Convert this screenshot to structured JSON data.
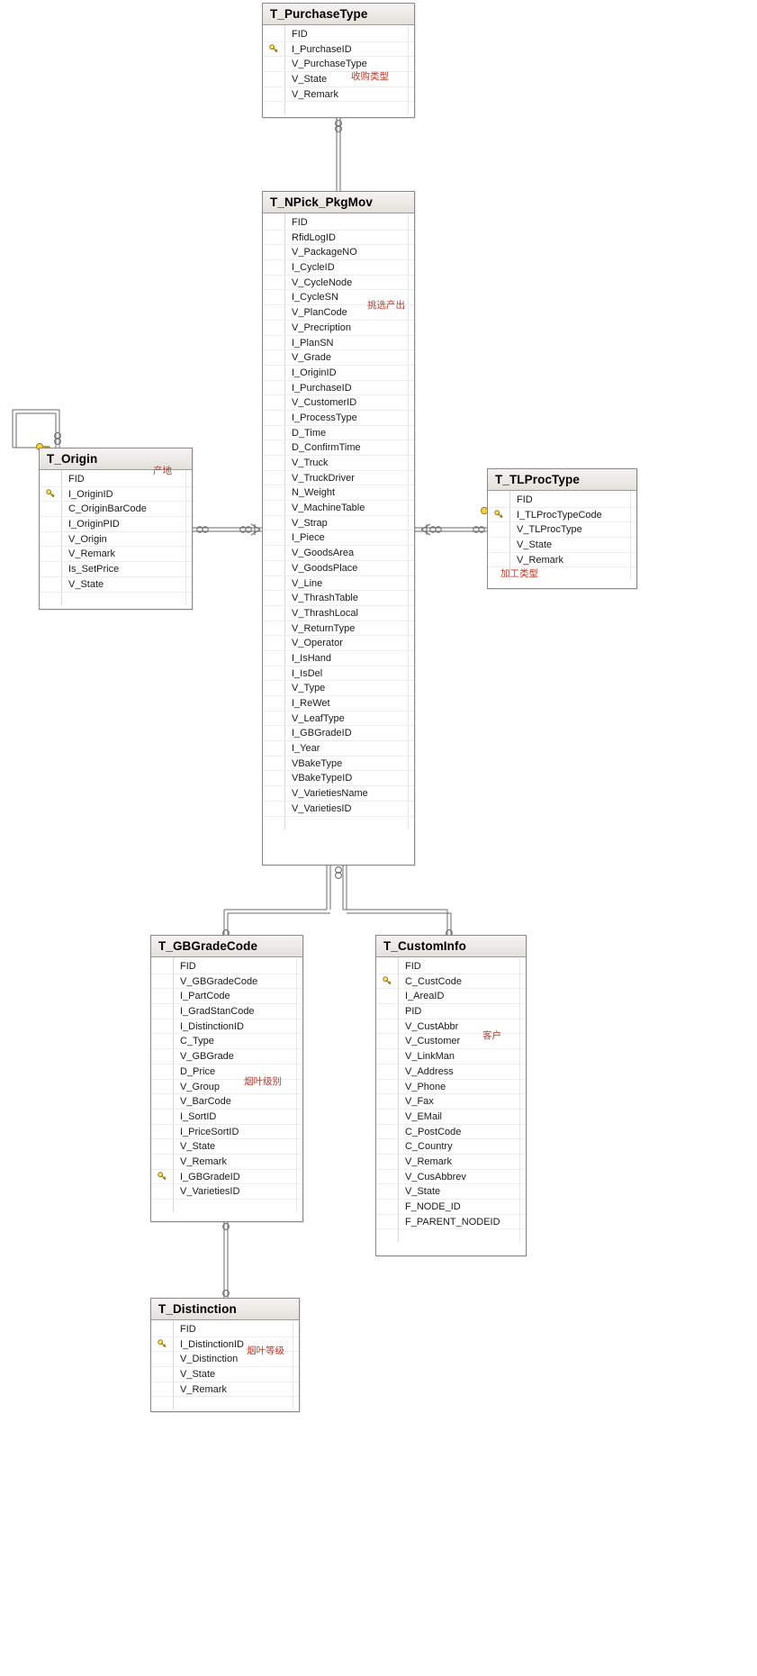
{
  "diagram": {
    "title": "Database ER Diagram",
    "accent_note_color": "#c0392b",
    "border_color": "#8a8a8a"
  },
  "entities": [
    {
      "id": "t-purchasetype",
      "name": "T_PurchaseType",
      "note": "收购类型",
      "fields": [
        {
          "name": "FID",
          "pk": false
        },
        {
          "name": "I_PurchaseID",
          "pk": true
        },
        {
          "name": "V_PurchaseType",
          "pk": false
        },
        {
          "name": "V_State",
          "pk": false
        },
        {
          "name": "V_Remark",
          "pk": false
        }
      ]
    },
    {
      "id": "t-npick-pkgmov",
      "name": "T_NPick_PkgMov",
      "note": "挑选产出",
      "fields": [
        {
          "name": "FID",
          "pk": false
        },
        {
          "name": "RfidLogID",
          "pk": false
        },
        {
          "name": "V_PackageNO",
          "pk": false
        },
        {
          "name": "I_CycleID",
          "pk": false
        },
        {
          "name": "V_CycleNode",
          "pk": false
        },
        {
          "name": "I_CycleSN",
          "pk": false
        },
        {
          "name": "V_PlanCode",
          "pk": false
        },
        {
          "name": "V_Precription",
          "pk": false
        },
        {
          "name": "I_PlanSN",
          "pk": false
        },
        {
          "name": "V_Grade",
          "pk": false
        },
        {
          "name": "I_OriginID",
          "pk": false
        },
        {
          "name": "I_PurchaseID",
          "pk": false
        },
        {
          "name": "V_CustomerID",
          "pk": false
        },
        {
          "name": "I_ProcessType",
          "pk": false
        },
        {
          "name": "D_Time",
          "pk": false
        },
        {
          "name": "D_ConfirmTime",
          "pk": false
        },
        {
          "name": "V_Truck",
          "pk": false
        },
        {
          "name": "V_TruckDriver",
          "pk": false
        },
        {
          "name": "N_Weight",
          "pk": false
        },
        {
          "name": "V_MachineTable",
          "pk": false
        },
        {
          "name": "V_Strap",
          "pk": false
        },
        {
          "name": "I_Piece",
          "pk": false
        },
        {
          "name": "V_GoodsArea",
          "pk": false
        },
        {
          "name": "V_GoodsPlace",
          "pk": false
        },
        {
          "name": "V_Line",
          "pk": false
        },
        {
          "name": "V_ThrashTable",
          "pk": false
        },
        {
          "name": "V_ThrashLocal",
          "pk": false
        },
        {
          "name": "V_ReturnType",
          "pk": false
        },
        {
          "name": "V_Operator",
          "pk": false
        },
        {
          "name": "I_IsHand",
          "pk": false
        },
        {
          "name": "I_IsDel",
          "pk": false
        },
        {
          "name": "V_Type",
          "pk": false
        },
        {
          "name": "I_ReWet",
          "pk": false
        },
        {
          "name": "V_LeafType",
          "pk": false
        },
        {
          "name": "I_GBGradeID",
          "pk": false
        },
        {
          "name": "I_Year",
          "pk": false
        },
        {
          "name": "VBakeType",
          "pk": false
        },
        {
          "name": "VBakeTypeID",
          "pk": false
        },
        {
          "name": "V_VarietiesName",
          "pk": false
        },
        {
          "name": "V_VarietiesID",
          "pk": false
        }
      ]
    },
    {
      "id": "t-origin",
      "name": "T_Origin",
      "note": "产地",
      "fields": [
        {
          "name": "FID",
          "pk": false
        },
        {
          "name": "I_OriginID",
          "pk": true
        },
        {
          "name": "C_OriginBarCode",
          "pk": false
        },
        {
          "name": "I_OriginPID",
          "pk": false
        },
        {
          "name": "V_Origin",
          "pk": false
        },
        {
          "name": "V_Remark",
          "pk": false
        },
        {
          "name": "Is_SetPrice",
          "pk": false
        },
        {
          "name": "V_State",
          "pk": false
        }
      ]
    },
    {
      "id": "t-tlproctype",
      "name": "T_TLProcType",
      "note": "加工类型",
      "fields": [
        {
          "name": "FID",
          "pk": false
        },
        {
          "name": "I_TLProcTypeCode",
          "pk": true
        },
        {
          "name": "V_TLProcType",
          "pk": false
        },
        {
          "name": "V_State",
          "pk": false
        },
        {
          "name": "V_Remark",
          "pk": false
        }
      ]
    },
    {
      "id": "t-gbgradecode",
      "name": "T_GBGradeCode",
      "note": "烟叶级别",
      "fields": [
        {
          "name": "FID",
          "pk": false
        },
        {
          "name": "V_GBGradeCode",
          "pk": false
        },
        {
          "name": "I_PartCode",
          "pk": false
        },
        {
          "name": "I_GradStanCode",
          "pk": false
        },
        {
          "name": "I_DistinctionID",
          "pk": false
        },
        {
          "name": "C_Type",
          "pk": false
        },
        {
          "name": "V_GBGrade",
          "pk": false
        },
        {
          "name": "D_Price",
          "pk": false
        },
        {
          "name": "V_Group",
          "pk": false
        },
        {
          "name": "V_BarCode",
          "pk": false
        },
        {
          "name": "I_SortID",
          "pk": false
        },
        {
          "name": "I_PriceSortID",
          "pk": false
        },
        {
          "name": "V_State",
          "pk": false
        },
        {
          "name": "V_Remark",
          "pk": false
        },
        {
          "name": "I_GBGradeID",
          "pk": true
        },
        {
          "name": "V_VarietiesID",
          "pk": false
        }
      ]
    },
    {
      "id": "t-custominfo",
      "name": "T_CustomInfo",
      "note": "客户",
      "fields": [
        {
          "name": "FID",
          "pk": false
        },
        {
          "name": "C_CustCode",
          "pk": true
        },
        {
          "name": "I_AreaID",
          "pk": false
        },
        {
          "name": "PID",
          "pk": false
        },
        {
          "name": "V_CustAbbr",
          "pk": false
        },
        {
          "name": "V_Customer",
          "pk": false
        },
        {
          "name": "V_LinkMan",
          "pk": false
        },
        {
          "name": "V_Address",
          "pk": false
        },
        {
          "name": "V_Phone",
          "pk": false
        },
        {
          "name": "V_Fax",
          "pk": false
        },
        {
          "name": "V_EMail",
          "pk": false
        },
        {
          "name": "C_PostCode",
          "pk": false
        },
        {
          "name": "C_Country",
          "pk": false
        },
        {
          "name": "V_Remark",
          "pk": false
        },
        {
          "name": "V_CusAbbrev",
          "pk": false
        },
        {
          "name": "V_State",
          "pk": false
        },
        {
          "name": "F_NODE_ID",
          "pk": false
        },
        {
          "name": "F_PARENT_NODEID",
          "pk": false
        }
      ]
    },
    {
      "id": "t-distinction",
      "name": "T_Distinction",
      "note": "烟叶等级",
      "fields": [
        {
          "name": "FID",
          "pk": false
        },
        {
          "name": "I_DistinctionID",
          "pk": true
        },
        {
          "name": "V_Distinction",
          "pk": false
        },
        {
          "name": "V_State",
          "pk": false
        },
        {
          "name": "V_Remark",
          "pk": false
        }
      ]
    }
  ],
  "relationships": [
    {
      "id": "rel-purchasetype-npick",
      "from": "T_PurchaseType",
      "to": "T_NPick_PkgMov",
      "from_card": "one",
      "to_card": "one"
    },
    {
      "id": "rel-origin-npick",
      "from": "T_Origin",
      "to": "T_NPick_PkgMov",
      "from_card": "one",
      "to_card": "many"
    },
    {
      "id": "rel-origin-self",
      "from": "T_Origin",
      "to": "T_Origin",
      "from_card": "one",
      "to_card": "many"
    },
    {
      "id": "rel-tlproctype-npick",
      "from": "T_TLProcType",
      "to": "T_NPick_PkgMov",
      "from_card": "one",
      "to_card": "many"
    },
    {
      "id": "rel-gbgradecode-npick",
      "from": "T_GBGradeCode",
      "to": "T_NPick_PkgMov",
      "from_card": "one",
      "to_card": "one"
    },
    {
      "id": "rel-custominfo-npick",
      "from": "T_CustomInfo",
      "to": "T_NPick_PkgMov",
      "from_card": "one",
      "to_card": "one"
    },
    {
      "id": "rel-distinction-gbgrade",
      "from": "T_Distinction",
      "to": "T_GBGradeCode",
      "from_card": "one",
      "to_card": "one"
    }
  ],
  "icons": {
    "primary_key": "key-icon"
  }
}
